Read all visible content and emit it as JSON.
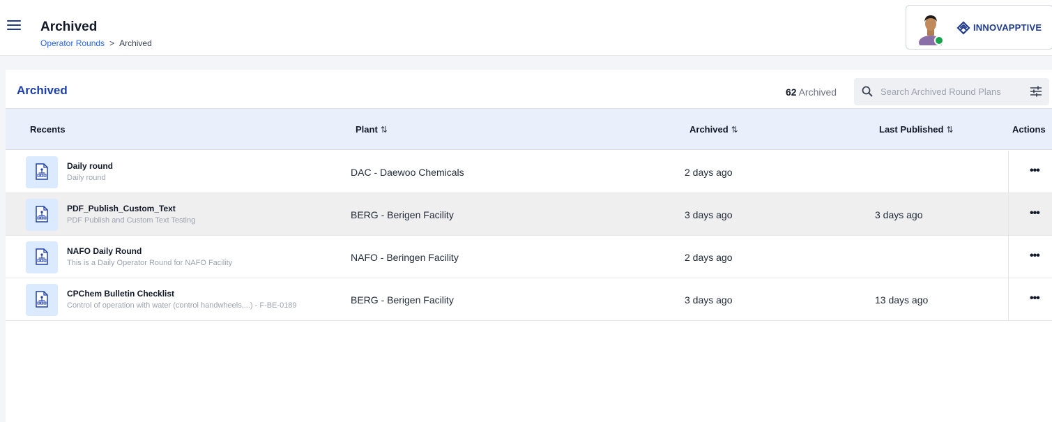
{
  "header": {
    "title": "Archived",
    "breadcrumb": {
      "link": "Operator Rounds",
      "separator": ">",
      "current": "Archived"
    },
    "brand": "INNOVAPPTIVE",
    "status_color": "#16a34a"
  },
  "panel": {
    "title": "Archived",
    "count_value": "62",
    "count_label": "Archived",
    "search_placeholder": "Search Archived Round Plans"
  },
  "table": {
    "columns": [
      "Recents",
      "Plant",
      "Archived",
      "Last Published",
      "Actions"
    ],
    "sort_icon": "⇅",
    "actions_icon": "•••",
    "rows": [
      {
        "name": "Daily round",
        "description": "Daily round",
        "plant": "DAC - Daewoo Chemicals",
        "archived": "2 days ago",
        "last_published": ""
      },
      {
        "name": "PDF_Publish_Custom_Text",
        "description": "PDF Publish and Custom Text Testing",
        "plant": "BERG - Berigen Facility",
        "archived": "3 days ago",
        "last_published": "3 days ago"
      },
      {
        "name": "NAFO Daily Round",
        "description": "This is a Daily Operator Round for NAFO Facility",
        "plant": "NAFO - Beringen Facility",
        "archived": "2 days ago",
        "last_published": ""
      },
      {
        "name": "CPChem Bulletin Checklist",
        "description": "Control of operation with water (control handwheels,...) - F-BE-0189",
        "plant": "BERG - Berigen Facility",
        "archived": "3 days ago",
        "last_published": "13 days ago"
      }
    ]
  },
  "colors": {
    "accent": "#1e40af",
    "link": "#2563eb",
    "header_bg": "#eaf0fb",
    "icon_bg": "#dbeafe"
  }
}
